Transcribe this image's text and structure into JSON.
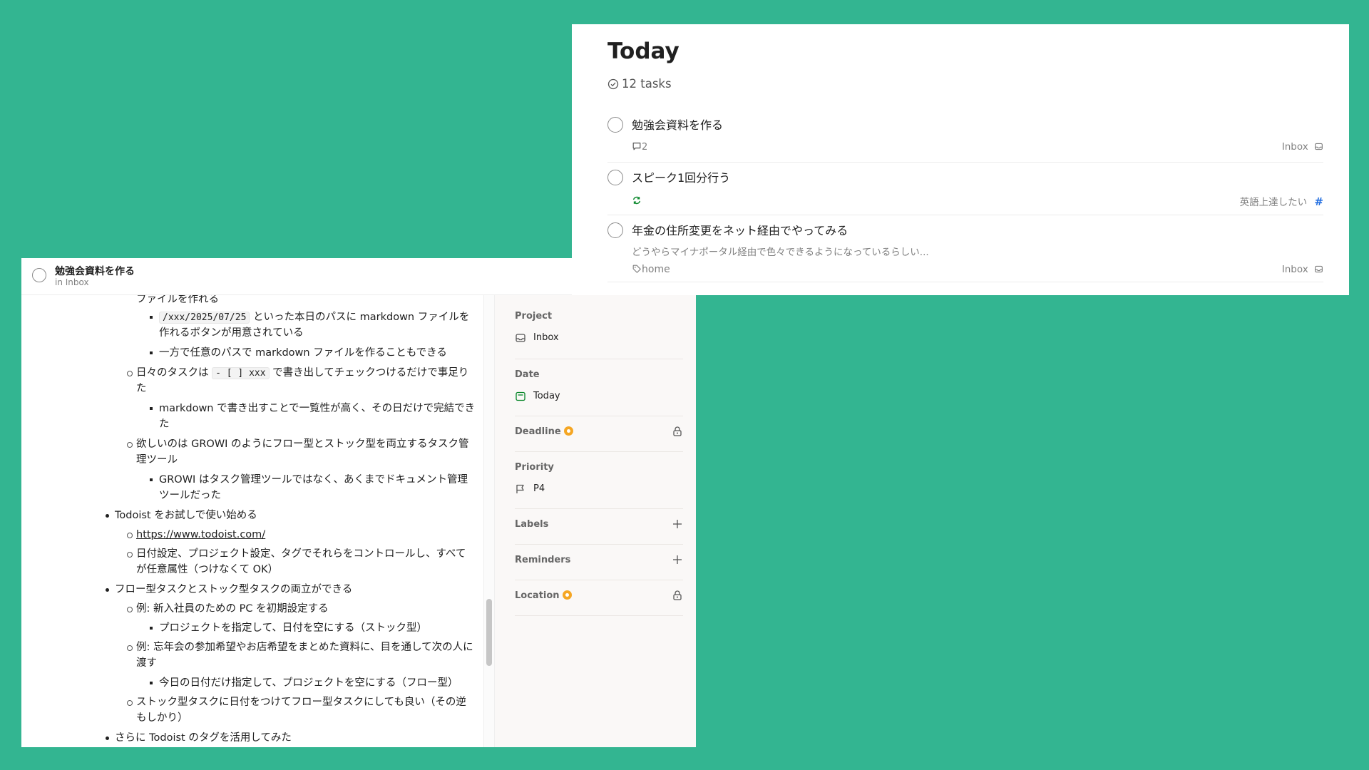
{
  "detail": {
    "task_title": "勉強会資料を作る",
    "task_location": "in Inbox",
    "notes": {
      "l1": "ファイルを作れる",
      "l2a_code": "/xxx/2025/07/25",
      "l2a_text": " といった本日のパスに markdown ファイルを",
      "l2b": "作れるボタンが用意されている",
      "l3": "一方で任意のパスで markdown ファイルを作ることもできる",
      "l4a_pre": "日々のタスクは ",
      "l4a_code": "- [ ] xxx",
      "l4a_post": " で書き出してチェックつけるだけで事足り",
      "l4b": "た",
      "l5a": "markdown で書き出すことで一覧性が高く、その日だけで完結でき",
      "l5b": "た",
      "l6a": "欲しいのは GROWI のようにフロー型とストック型を両立するタスク管",
      "l6b": "理ツール",
      "l7a": "GROWI はタスク管理ツールではなく、あくまでドキュメント管理",
      "l7b": "ツールだった",
      "l8": "Todoist をお試しで使い始める",
      "l9": "https://www.todoist.com/",
      "l10a": "日付設定、プロジェクト設定、タグでそれらをコントロールし、すべて",
      "l10b": "が任意属性（つけなくて OK）",
      "l11": "フロー型タスクとストック型タスクの両立ができる",
      "l12": "例: 新入社員のための PC を初期設定する",
      "l13": "プロジェクトを指定して、日付を空にする（ストック型）",
      "l14a": "例: 忘年会の参加希望やお店希望をまとめた資料に、目を通して次の人に",
      "l14b": "渡す",
      "l15": "今日の日付だけ指定して、プロジェクトを空にする（フロー型）",
      "l16a": "ストック型タスクに日付をつけてフロー型タスクにしても良い（その逆",
      "l16b": "もしかり）",
      "l17": "さらに Todoist のタグを活用してみた"
    },
    "sidebar": {
      "project_label": "Project",
      "project_value": "Inbox",
      "date_label": "Date",
      "date_value": "Today",
      "deadline_label": "Deadline",
      "priority_label": "Priority",
      "priority_value": "P4",
      "labels_label": "Labels",
      "reminders_label": "Reminders",
      "location_label": "Location"
    }
  },
  "today": {
    "title": "Today",
    "count": "12 tasks",
    "tasks": [
      {
        "name": "勉強会資料を作る",
        "comments": "2",
        "project": "Inbox"
      },
      {
        "name": "スピーク1回分行う",
        "project": "英語上達したい"
      },
      {
        "name": "年金の住所変更をネット経由でやってみる",
        "description": "どうやらマイナポータル経由で色々できるようになっているらしい...",
        "label": "home",
        "project": "Inbox"
      }
    ]
  },
  "colors": {
    "background": "#33b591",
    "accent_star": "#f5a623",
    "recurring_green": "#058527",
    "project_hash_blue": "#246fe0"
  }
}
